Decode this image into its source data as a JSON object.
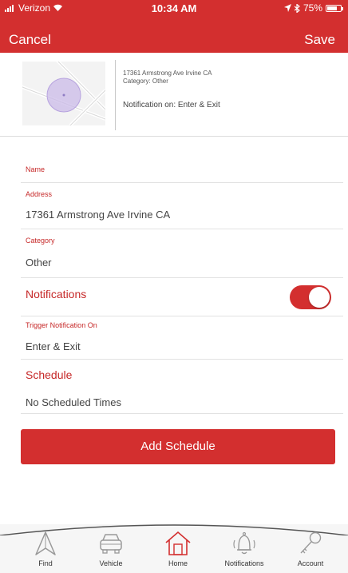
{
  "status_bar": {
    "carrier": "Verizon",
    "time": "10:34 AM",
    "battery": "75%",
    "battery_level": 0.75
  },
  "nav": {
    "cancel_label": "Cancel",
    "save_label": "Save"
  },
  "summary": {
    "address": "17361 Armstrong Ave Irvine CA",
    "category": "Category: Other",
    "notification": "Notification on: Enter & Exit"
  },
  "form": {
    "name_label": "Name",
    "name_value": "",
    "address_label": "Address",
    "address_value": "17361 Armstrong Ave Irvine CA",
    "category_label": "Category",
    "category_value": "Other",
    "notifications_label": "Notifications",
    "notifications_on": true,
    "trigger_label": "Trigger Notification On",
    "trigger_value": "Enter & Exit",
    "schedule_label": "Schedule",
    "schedule_value": "No Scheduled Times"
  },
  "add_schedule_label": "Add Schedule",
  "tabs": [
    {
      "label": "Find",
      "icon": "find-icon"
    },
    {
      "label": "Vehicle",
      "icon": "vehicle-icon"
    },
    {
      "label": "Home",
      "icon": "home-icon"
    },
    {
      "label": "Notifications",
      "icon": "bell-icon"
    },
    {
      "label": "Account",
      "icon": "key-icon"
    }
  ],
  "colors": {
    "brand": "#d32f2f",
    "label": "#c62828",
    "geofence": "#cbbbe8"
  }
}
